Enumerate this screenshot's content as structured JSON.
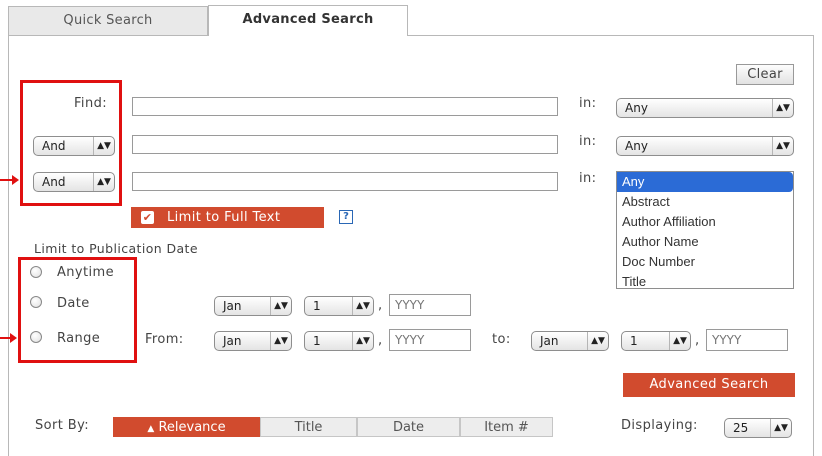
{
  "tabs": {
    "quick": "Quick Search",
    "advanced": "Advanced Search"
  },
  "clear_label": "Clear",
  "find_label": "Find:",
  "in_label": "in:",
  "rows": [
    {
      "operator": "",
      "value": "",
      "field": "Any"
    },
    {
      "operator": "And",
      "value": "",
      "field": "Any"
    },
    {
      "operator": "And",
      "value": "",
      "field": "Any"
    }
  ],
  "field_options": [
    "Any",
    "Abstract",
    "Author Affiliation",
    "Author Name",
    "Doc Number",
    "Title"
  ],
  "limit_full_text": {
    "label": "Limit to Full Text",
    "checked": true,
    "help": "?"
  },
  "pub_date": {
    "heading": "Limit to Publication Date",
    "options": [
      "Anytime",
      "Date",
      "Range"
    ],
    "date": {
      "month": "Jan",
      "day": "1",
      "year_placeholder": "YYYY"
    },
    "range": {
      "from_label": "From:",
      "to_label": "to:",
      "from_month": "Jan",
      "from_day": "1",
      "to_month": "Jan",
      "to_day": "1",
      "year_placeholder": "YYYY"
    },
    "comma": ","
  },
  "advanced_search_button": "Advanced Search",
  "sort": {
    "label": "Sort By:",
    "options": [
      "Relevance",
      "Title",
      "Date",
      "Item #"
    ],
    "active": "Relevance"
  },
  "displaying": {
    "label": "Displaying:",
    "value": "25"
  },
  "colors": {
    "accent_red": "#d14b2e",
    "highlight_red": "#e01010",
    "select_blue": "#2b6bd6"
  }
}
